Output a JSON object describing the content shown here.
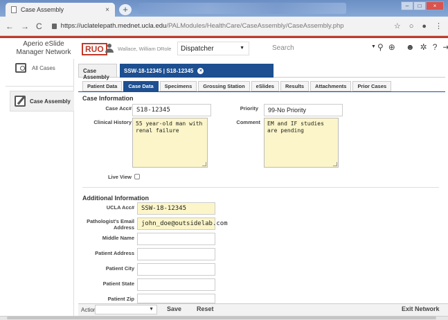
{
  "browser": {
    "tab_title": "Case Assembly",
    "url_host": "https://uclatelepath.mednet.ucla.edu",
    "url_path": "/PALModules/HealthCare/CaseAssembly/CaseAssembly.php"
  },
  "header": {
    "brand": "Aperio eSlide Manager Network",
    "ruo": "RUO",
    "username": "Wallace, William D",
    "role_label": "Role",
    "role_value": "Dispatcher",
    "search_placeholder": "Search"
  },
  "sidebar": {
    "all_cases": "All Cases",
    "case_assembly": "Case Assembly"
  },
  "main_tabs": {
    "case_assembly": "Case Assembly",
    "case_tab": "SSW-18-12345 | S18-12345"
  },
  "sub_tabs": [
    "Patient Data",
    "Case Data",
    "Specimens",
    "Grossing Station",
    "eSlides",
    "Results",
    "Attachments",
    "Prior Cases"
  ],
  "case_info": {
    "title": "Case Information",
    "case_acc_label": "Case Acc#",
    "case_acc_value": "S18-12345",
    "priority_label": "Priority",
    "priority_value": "99-No Priority",
    "clinical_history_label": "Clinical History",
    "clinical_history_value": "55 year-old man with renal failure",
    "comment_label": "Comment",
    "comment_value": "EM and IF studies are pending",
    "live_view_label": "Live View"
  },
  "additional_info": {
    "title": "Additional Information",
    "ucla_acc_label": "UCLA Acc#",
    "ucla_acc_value": "SSW-18-12345",
    "email_label": "Pathologist's Email Address",
    "email_value": "john_doe@outsidelab.com",
    "middle_name_label": "Middle Name",
    "patient_address_label": "Patient Address",
    "patient_city_label": "Patient City",
    "patient_state_label": "Patient State",
    "patient_zip_label": "Patient Zip"
  },
  "bottom": {
    "action_label": "Action:",
    "save": "Save",
    "reset": "Reset",
    "exit": "Exit Network"
  },
  "colors": {
    "accent": "#1d4f91",
    "ruo_red": "#c0392b",
    "field_yellow": "#fbf5c9"
  }
}
